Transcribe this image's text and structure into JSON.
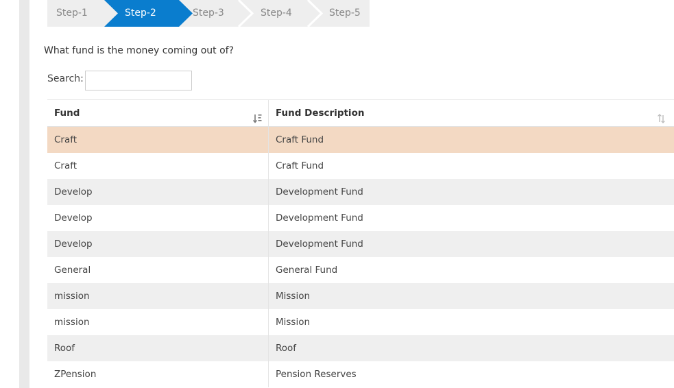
{
  "wizard": {
    "steps": [
      {
        "label": "Step-1",
        "active": false
      },
      {
        "label": "Step-2",
        "active": true
      },
      {
        "label": "Step-3",
        "active": false
      },
      {
        "label": "Step-4",
        "active": false
      },
      {
        "label": "Step-5",
        "active": false
      }
    ],
    "active_color": "#0a7dce"
  },
  "question": "What fund is the money coming out of?",
  "search": {
    "label": "Search:",
    "value": "",
    "placeholder": ""
  },
  "table": {
    "headers": [
      "Fund",
      "Fund Description"
    ],
    "sort_icons": [
      "sort-alpha-asc-icon",
      "sort-unsorted-icon"
    ],
    "rows": [
      {
        "fund": "Craft",
        "description": "Craft Fund",
        "selected": true
      },
      {
        "fund": "Craft",
        "description": "Craft Fund",
        "selected": false
      },
      {
        "fund": "Develop",
        "description": "Development Fund",
        "selected": false
      },
      {
        "fund": "Develop",
        "description": "Development Fund",
        "selected": false
      },
      {
        "fund": "Develop",
        "description": "Development Fund",
        "selected": false
      },
      {
        "fund": "General",
        "description": "General Fund",
        "selected": false
      },
      {
        "fund": "mission",
        "description": "Mission",
        "selected": false
      },
      {
        "fund": "mission",
        "description": "Mission",
        "selected": false
      },
      {
        "fund": "Roof",
        "description": "Roof",
        "selected": false
      },
      {
        "fund": "ZPension",
        "description": "Pension Reserves",
        "selected": false
      }
    ],
    "selected_color": "#f3d9c3"
  }
}
